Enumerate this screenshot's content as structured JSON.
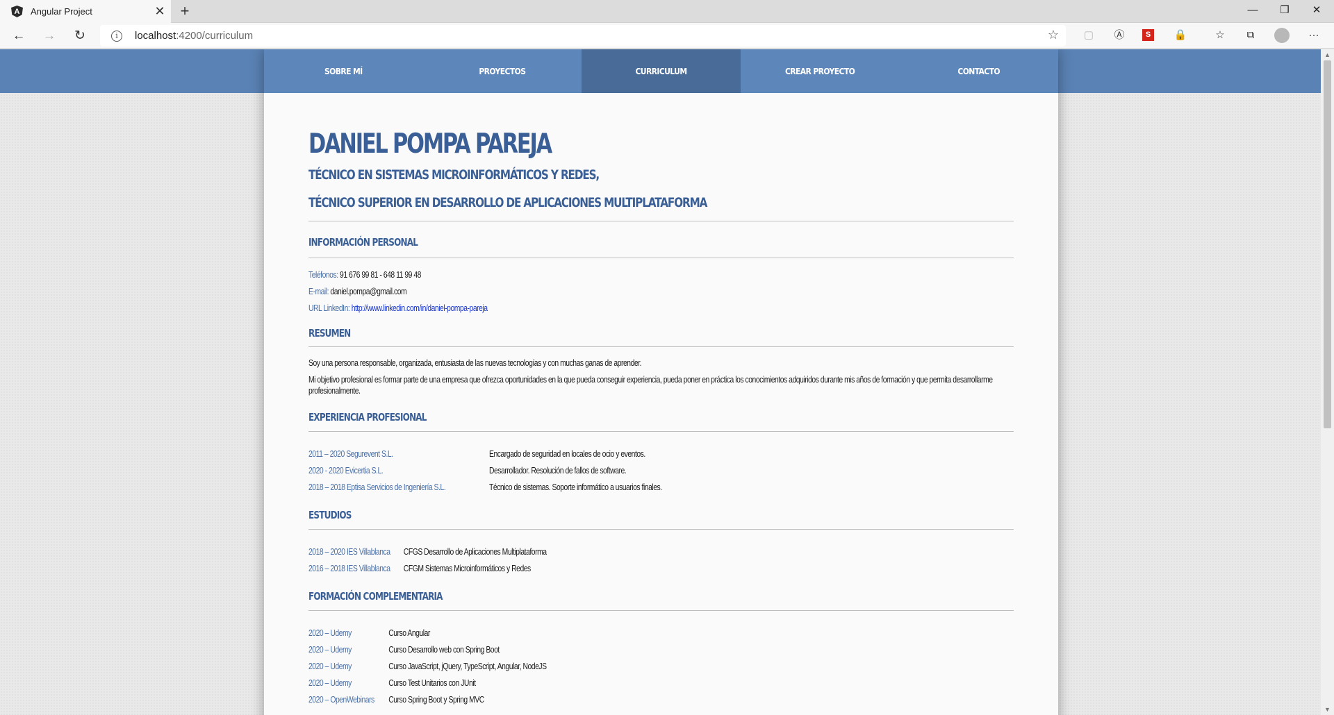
{
  "browser": {
    "tab_title": "Angular Project",
    "favicon_letter": "A",
    "url_host": "localhost",
    "url_path": ":4200/curriculum"
  },
  "nav": {
    "items": [
      {
        "label": "SOBRE MÍ",
        "active": false
      },
      {
        "label": "PROYECTOS",
        "active": false
      },
      {
        "label": "CURRICULUM",
        "active": true
      },
      {
        "label": "CREAR PROYECTO",
        "active": false
      },
      {
        "label": "CONTACTO",
        "active": false
      }
    ]
  },
  "header": {
    "name": "DANIEL POMPA PAREJA",
    "subtitle1": "TÉCNICO EN SISTEMAS MICROINFORMÁTICOS Y REDES,",
    "subtitle2": "TÉCNICO SUPERIOR EN DESARROLLO DE APLICACIONES MULTIPLATAFORMA"
  },
  "personal": {
    "title": "INFORMACIÓN PERSONAL",
    "phone_label": "Teléfonos:",
    "phone_value": "91 676 99 81 - 648 11 99 48",
    "email_label": "E-mail:",
    "email_value": "daniel.pompa@gmail.com",
    "linkedin_label": "URL LinkedIn:",
    "linkedin_value": "http://www.linkedin.com/in/daniel-pompa-pareja"
  },
  "summary": {
    "title": "RESUMEN",
    "p1": "Soy una persona responsable, organizada, entusiasta de las nuevas tecnologías y con muchas ganas de aprender.",
    "p2": "Mi objetivo profesional es formar parte de una empresa que ofrezca oportunidades en la que pueda conseguir experiencia, pueda poner en práctica los conocimientos adquiridos durante mis años de formación y que permita desarrollarme profesionalmente."
  },
  "experience": {
    "title": "EXPERIENCIA PROFESIONAL",
    "items": [
      {
        "period": "2011 – 2020 Segurevent S.L.",
        "desc": "Encargado de seguridad en locales de ocio y eventos."
      },
      {
        "period": "2020 - 2020 Evicertia S.L.",
        "desc": "Desarrollador. Resolución de fallos de software."
      },
      {
        "period": "2018 – 2018 Eptisa Servicios de Ingeniería S.L.",
        "desc": "Técnico de sistemas. Soporte informático a usuarios finales."
      }
    ]
  },
  "studies": {
    "title": "ESTUDIOS",
    "items": [
      {
        "period": "2018 – 2020 IES Villablanca",
        "desc": "CFGS Desarrollo de Aplicaciones Multiplataforma"
      },
      {
        "period": "2016 – 2018 IES Villablanca",
        "desc": "CFGM Sistemas Microinformáticos y Redes"
      }
    ]
  },
  "training": {
    "title": "FORMACIÓN COMPLEMENTARIA",
    "items": [
      {
        "period": "2020 – Udemy",
        "desc": "Curso Angular"
      },
      {
        "period": "2020 – Udemy",
        "desc": "Curso Desarrollo web con Spring Boot"
      },
      {
        "period": "2020 – Udemy",
        "desc": "Curso JavaScript, jQuery, TypeScript, Angular, NodeJS"
      },
      {
        "period": "2020 – Udemy",
        "desc": "Curso Test Unitarios con JUnit"
      },
      {
        "period": "2020 – OpenWebinars",
        "desc": "Curso Spring Boot y Spring MVC"
      }
    ]
  }
}
